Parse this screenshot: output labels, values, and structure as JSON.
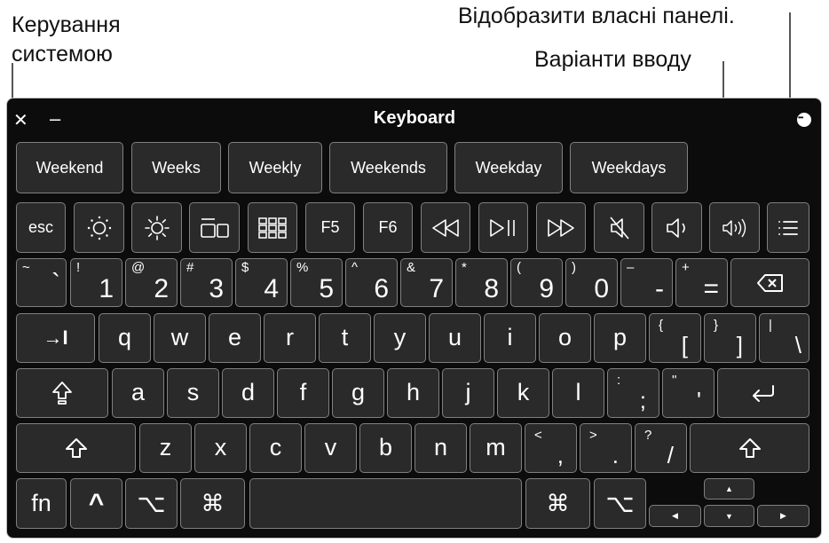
{
  "callouts": {
    "system_control": [
      "Керування",
      "системою"
    ],
    "custom_panels": "Відобразити власні панелі.",
    "typing_suggestions": "Варіанти вводу"
  },
  "window": {
    "title": "Keyboard",
    "close_glyph": "✕",
    "minimize_glyph": "–",
    "menu_glyph": "•••"
  },
  "suggestions": [
    "Weekend",
    "Weeks",
    "Weekly",
    "Weekends",
    "Weekday",
    "Weekdays"
  ],
  "function_row": {
    "esc": "esc",
    "f5": "F5",
    "f6": "F6"
  },
  "number_row": [
    {
      "shift": "~",
      "main": "`"
    },
    {
      "shift": "!",
      "main": "1"
    },
    {
      "shift": "@",
      "main": "2"
    },
    {
      "shift": "#",
      "main": "3"
    },
    {
      "shift": "$",
      "main": "4"
    },
    {
      "shift": "%",
      "main": "5"
    },
    {
      "shift": "^",
      "main": "6"
    },
    {
      "shift": "&",
      "main": "7"
    },
    {
      "shift": "*",
      "main": "8"
    },
    {
      "shift": "(",
      "main": "9"
    },
    {
      "shift": ")",
      "main": "0"
    },
    {
      "shift": "–",
      "main": "-"
    },
    {
      "shift": "+",
      "main": "="
    }
  ],
  "row_q": {
    "letters": [
      "q",
      "w",
      "e",
      "r",
      "t",
      "y",
      "u",
      "i",
      "o",
      "p"
    ],
    "tab": "→I",
    "bracket_left": {
      "top": "{",
      "bottom": "["
    },
    "bracket_right": {
      "top": "}",
      "bottom": "]"
    },
    "backslash": {
      "top": "|",
      "bottom": "\\"
    }
  },
  "row_a": {
    "letters": [
      "a",
      "s",
      "d",
      "f",
      "g",
      "h",
      "j",
      "k",
      "l"
    ],
    "semicolon": {
      "top": ":",
      "bottom": ";"
    },
    "quote": {
      "top": "\"",
      "bottom": "'"
    }
  },
  "row_z": {
    "letters": [
      "z",
      "x",
      "c",
      "v",
      "b",
      "n",
      "m"
    ],
    "comma": {
      "top": "<",
      "bottom": ","
    },
    "period": {
      "top": ">",
      "bottom": "."
    },
    "slash": {
      "top": "?",
      "bottom": "/"
    }
  },
  "bottom_row": {
    "fn": "fn",
    "control": "^",
    "option": "⌥",
    "command": "⌘",
    "arrow_up": "▲",
    "arrow_left": "◀",
    "arrow_down": "▼",
    "arrow_right": "▶"
  },
  "icons": {
    "close": "close-icon",
    "minimize": "minimize-icon",
    "menu": "more-icon",
    "brightness_down": "brightness-down-icon",
    "brightness_up": "brightness-up-icon",
    "mission_control": "mission-control-icon",
    "launchpad": "launchpad-icon",
    "rewind": "rewind-icon",
    "play_pause": "play-pause-icon",
    "fast_forward": "fast-forward-icon",
    "mute": "mute-icon",
    "volume_down": "volume-down-icon",
    "volume_up": "volume-up-icon",
    "custom_panels": "list-icon",
    "delete": "delete-icon",
    "caps_lock": "caps-lock-icon",
    "return": "return-icon",
    "shift": "shift-icon"
  }
}
